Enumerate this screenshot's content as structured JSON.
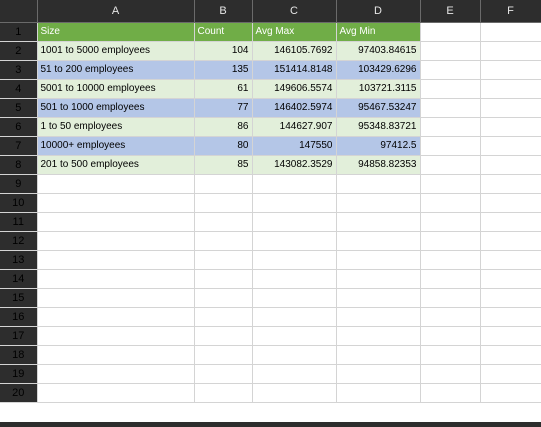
{
  "colors": {
    "header_bg": "#2d2d2d",
    "table_header": "#70ad47",
    "band_green": "#e2efda",
    "band_blue": "#b4c6e7"
  },
  "columns": [
    "A",
    "B",
    "C",
    "D",
    "E",
    "F"
  ],
  "rows": [
    "1",
    "2",
    "3",
    "4",
    "5",
    "6",
    "7",
    "8",
    "9",
    "10",
    "11",
    "12",
    "13",
    "14",
    "15",
    "16",
    "17",
    "18",
    "19",
    "20"
  ],
  "table": {
    "headers": [
      "Size",
      "Count",
      "Avg Max",
      "Avg Min"
    ],
    "data": [
      [
        "1001 to 5000 employees",
        "104",
        "146105.7692",
        "97403.84615"
      ],
      [
        "51 to 200 employees",
        "135",
        "151414.8148",
        "103429.6296"
      ],
      [
        "5001 to 10000 employees",
        "61",
        "149606.5574",
        "103721.3115"
      ],
      [
        "501 to 1000 employees",
        "77",
        "146402.5974",
        "95467.53247"
      ],
      [
        "1 to 50 employees",
        "86",
        "144627.907",
        "95348.83721"
      ],
      [
        "10000+ employees",
        "80",
        "147550",
        "97412.5"
      ],
      [
        "201 to 500 employees",
        "85",
        "143082.3529",
        "94858.82353"
      ]
    ]
  }
}
